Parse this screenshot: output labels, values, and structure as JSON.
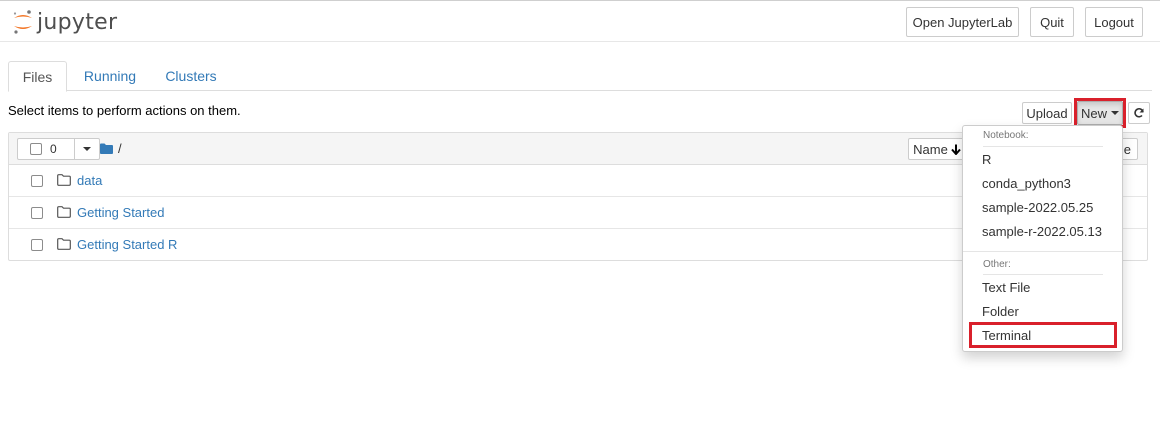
{
  "app": {
    "logo_text": "jupyter"
  },
  "header": {
    "open_jupyterlab": "Open JupyterLab",
    "quit": "Quit",
    "logout": "Logout"
  },
  "tabs": [
    {
      "label": "Files",
      "active": true
    },
    {
      "label": "Running",
      "active": false
    },
    {
      "label": "Clusters",
      "active": false
    }
  ],
  "toolbar": {
    "hint": "Select items to perform actions on them.",
    "upload": "Upload",
    "new": "New"
  },
  "list": {
    "selected_count": "0",
    "breadcrumb": "/",
    "sort_label": "Name",
    "size_label_partial": "e",
    "items": [
      {
        "name": "data",
        "type": "folder"
      },
      {
        "name": "Getting Started",
        "type": "folder"
      },
      {
        "name": "Getting Started R",
        "type": "folder"
      }
    ]
  },
  "new_menu": {
    "notebook_header": "Notebook:",
    "notebooks": [
      "R",
      "conda_python3",
      "sample-2022.05.25",
      "sample-r-2022.05.13"
    ],
    "other_header": "Other:",
    "other": [
      "Text File",
      "Folder",
      "Terminal"
    ]
  },
  "colors": {
    "link": "#337ab7",
    "highlight": "#d9202b",
    "logo_orange": "#f37626"
  }
}
